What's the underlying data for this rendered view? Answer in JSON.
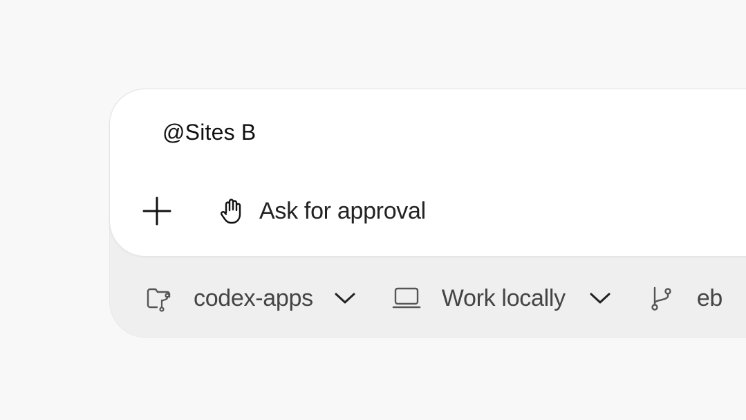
{
  "composer": {
    "prompt_text": "@Sites B",
    "approval_label": "Ask for approval"
  },
  "footer": {
    "repo_label": "codex-apps",
    "env_label": "Work locally",
    "branch_label": "eb"
  },
  "icons": {
    "add": "plus-icon",
    "approval": "hand-icon",
    "repo": "folder-branch-icon",
    "env": "laptop-icon",
    "branch": "git-branch-icon",
    "dropdown": "chevron-down-icon"
  },
  "colors": {
    "background": "#f8f8f8",
    "card": "#ffffff",
    "footer_panel": "#efefef",
    "text_primary": "#111111",
    "text_secondary": "#444444"
  }
}
